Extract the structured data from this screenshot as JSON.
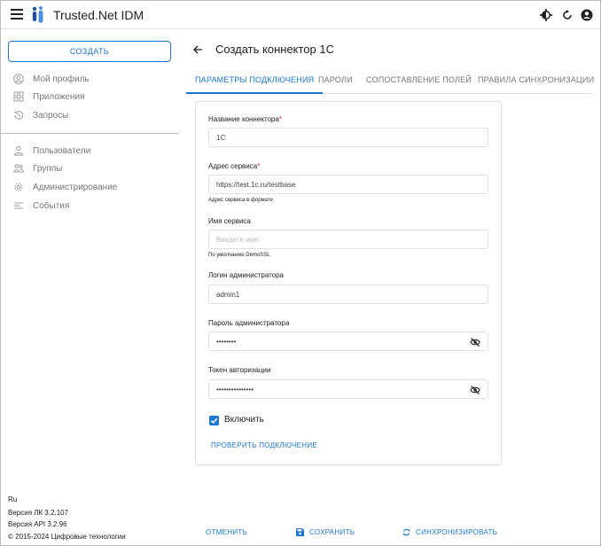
{
  "header": {
    "app_title": "Trusted.Net IDM"
  },
  "sidebar": {
    "create_label": "СОЗДАТЬ",
    "top_items": [
      {
        "label": "Мой профиль",
        "icon": "user-circle-icon"
      },
      {
        "label": "Приложения",
        "icon": "apps-icon"
      },
      {
        "label": "Запросы",
        "icon": "history-icon"
      }
    ],
    "admin_items": [
      {
        "label": "Пользователи",
        "icon": "person-icon"
      },
      {
        "label": "Группы",
        "icon": "group-icon"
      },
      {
        "label": "Администрирование",
        "icon": "gear-icon"
      },
      {
        "label": "События",
        "icon": "list-icon"
      }
    ],
    "footer": {
      "lang": "Ru",
      "lk_version": "Версия ЛК 3.2.107",
      "api_version": "Версия API 3.2.96",
      "copyright": "© 2015-2024 Цифровые технологии"
    }
  },
  "main": {
    "title": "Создать коннектор 1С",
    "tabs": [
      {
        "label": "ПАРАМЕТРЫ ПОДКЛЮЧЕНИЯ",
        "active": true
      },
      {
        "label": "ПАРОЛИ",
        "active": false
      },
      {
        "label": "СОПОСТАВЛЕНИЕ ПОЛЕЙ",
        "active": false
      },
      {
        "label": "ПРАВИЛА СИНХРОНИЗАЦИИ",
        "active": false
      }
    ],
    "form": {
      "connector_name": {
        "label": "Название коннектора",
        "required_mark": "*",
        "value": "1С"
      },
      "service_address": {
        "label": "Адрес сервиса",
        "required_mark": "*",
        "value": "https://test.1c.ru/testbase",
        "helper": "Адрес сервиса в формате"
      },
      "service_name": {
        "label": "Имя сервиса",
        "placeholder": "Введите имя",
        "helper": "По умолчанию DemoSSL"
      },
      "admin_login": {
        "label": "Логин администратора",
        "value": "admin1"
      },
      "admin_password": {
        "label": "Пароль администратора",
        "value": "••••••••"
      },
      "auth_token": {
        "label": "Токен авторизации",
        "value": "•••••••••••••••"
      },
      "enable": {
        "label": "Включить",
        "checked": true
      },
      "check_connection_label": "ПРОВЕРИТЬ ПОДКЛЮЧЕНИЕ"
    },
    "actions": {
      "cancel": "ОТМЕНИТЬ",
      "save": "СОХРАНИТЬ",
      "sync": "СИНХРОНИЗИРОВАТЬ"
    }
  },
  "colors": {
    "accent": "#1976d2",
    "required": "#d32f2f",
    "logo": "#1e4fa0"
  }
}
